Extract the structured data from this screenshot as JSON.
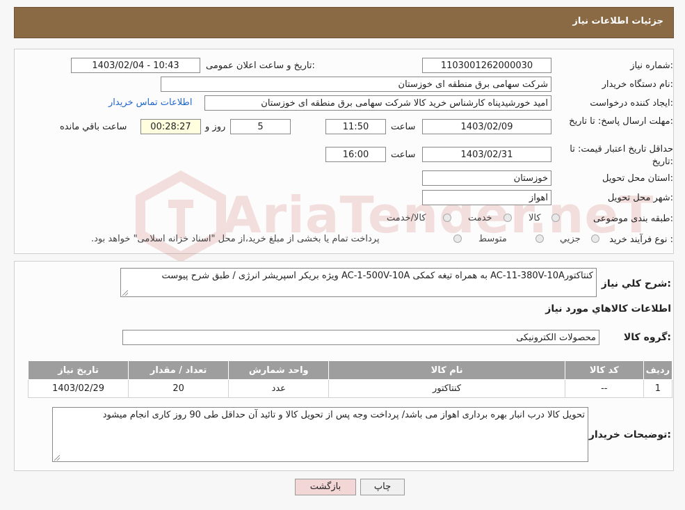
{
  "header": {
    "title": "جزئیات اطلاعات نیاز"
  },
  "form": {
    "need_number_label": "شماره نیاز:",
    "need_number": "1103001262000030",
    "announce_label": "تاریخ و ساعت اعلان عمومی:",
    "announce_value": "1403/02/04 - 10:43",
    "buyer_org_label": "نام دستگاه خریدار:",
    "buyer_org": "شرکت سهامی برق منطقه ای خوزستان",
    "creator_label": "ایجاد کننده درخواست:",
    "creator": "امید خورشیدپناه کارشناس خرید کالا شرکت سهامی برق منطقه ای خوزستان",
    "contact_link": "اطلاعات تماس خریدار",
    "deadline_label": "مهلت ارسال پاسخ: تا تاریخ:",
    "deadline_date": "1403/02/09",
    "time_label": "ساعت",
    "deadline_time": "11:50",
    "days_value": "5",
    "days_label": "روز و",
    "remaining_time": "00:28:27",
    "remaining_label": "ساعت باقي مانده",
    "validity_label": "حداقل تاریخ اعتبار قیمت: تا تاریخ:",
    "validity_date": "1403/02/31",
    "validity_time": "16:00",
    "province_label": "استان محل تحویل:",
    "province": "خوزستان",
    "city_label": "شهر محل تحویل:",
    "city": "اهواز",
    "category_label": "طبقه بندی موضوعی:",
    "category_options": [
      "کالا",
      "خدمت",
      "کالا/خدمت"
    ],
    "purchase_type_label": "نوع فرآیند خرید :",
    "purchase_options": [
      "جزيي",
      "متوسط"
    ],
    "purchase_note": "پرداخت تمام یا بخشی از مبلغ خرید،از محل \"اسناد خزانه اسلامی\" خواهد بود."
  },
  "description": {
    "label": "شرح کلي نياز:",
    "text": "کنتاکتورAC-11-380V-10A به همراه تیغه کمکی AC-1-500V-10A ویژه بریکر اسپریشر انرژی / طبق شرح پیوست"
  },
  "items_section": {
    "title": "اطلاعات کالاهاي مورد نياز",
    "group_label": "گروه کالا:",
    "group_value": "محصولات الکترونیکی",
    "columns": [
      "رديف",
      "کد کالا",
      "نام کالا",
      "واحد شمارش",
      "تعداد / مقدار",
      "تاریخ نیاز"
    ],
    "rows": [
      [
        "1",
        "--",
        "کنتاکتور",
        "عدد",
        "20",
        "1403/02/29"
      ]
    ]
  },
  "buyer_notes": {
    "label": "توضیحات خریدار:",
    "text": "تحویل کالا درب انبار بهره برداری اهواز می باشد/ پرداخت وجه پس از تحویل کالا و تائید آن حداقل طی 90 روز کاری انجام میشود"
  },
  "buttons": {
    "print": "چاپ",
    "back": "بازگشت"
  },
  "watermark": {
    "text": "AriaTender.neT"
  },
  "colors": {
    "header": "#8a6a45",
    "link": "#2266cc",
    "table_header": "#9e9e9e",
    "back_button": "#f3d6d6"
  }
}
